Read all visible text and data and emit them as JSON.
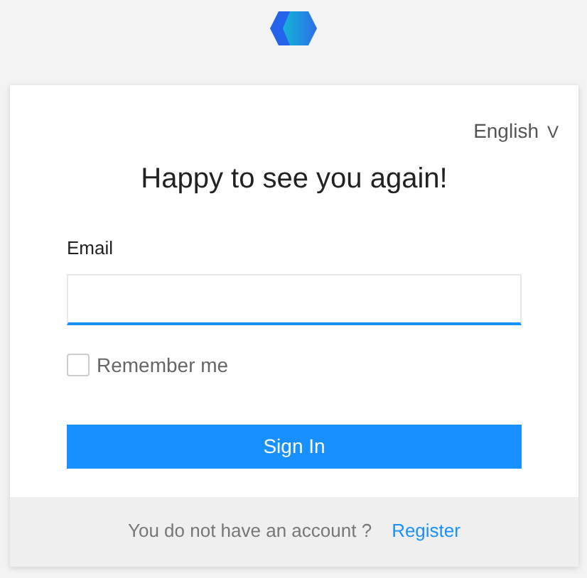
{
  "language_selector": {
    "label": "English",
    "caret": "V"
  },
  "heading": "Happy to see you again!",
  "email_field": {
    "label": "Email"
  },
  "remember_me": {
    "label": "Remember me",
    "checked": false
  },
  "sign_in_button": "Sign In",
  "footer": {
    "text": "You do not have an account ?",
    "link": "Register"
  }
}
